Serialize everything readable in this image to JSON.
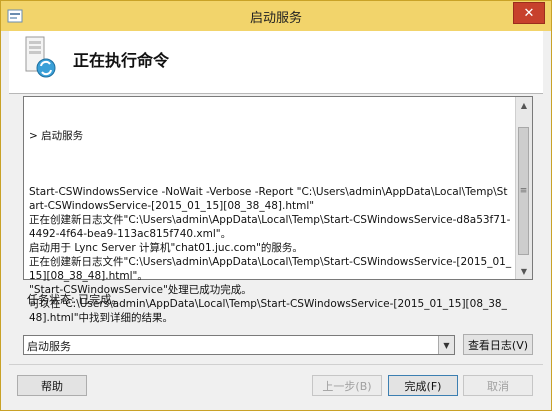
{
  "window": {
    "title": "启动服务",
    "close_symbol": "✕",
    "colors": {
      "titlebar": "#f2d46b",
      "close": "#c7412c",
      "border": "#c9a227"
    }
  },
  "header": {
    "title": "正在执行命令",
    "icon": "server-with-arrows-icon"
  },
  "log": {
    "section_header": "> 启动服务",
    "text": "Start-CSWindowsService -NoWait -Verbose -Report \"C:\\Users\\admin\\AppData\\Local\\Temp\\Start-CSWindowsService-[2015_01_15][08_38_48].html\"\n正在创建新日志文件\"C:\\Users\\admin\\AppData\\Local\\Temp\\Start-CSWindowsService-d8a53f71-4492-4f64-bea9-113ac815f740.xml\"。\n启动用于 Lync Server 计算机\"chat01.juc.com\"的服务。\n正在创建新日志文件\"C:\\Users\\admin\\AppData\\Local\\Temp\\Start-CSWindowsService-[2015_01_15][08_38_48].html\"。\n\"Start-CSWindowsService\"处理已成功完成。\n可以在\"C:\\Users\\admin\\AppData\\Local\\Temp\\Start-CSWindowsService-[2015_01_15][08_38_48].html\"中找到详细的结果。"
  },
  "status": {
    "text": "任务状态: 已完成。"
  },
  "combo": {
    "selected": "启动服务"
  },
  "buttons": {
    "view_log": "查看日志(V)",
    "help": "帮助",
    "back": "上一步(B)",
    "finish": "完成(F)",
    "cancel": "取消"
  }
}
